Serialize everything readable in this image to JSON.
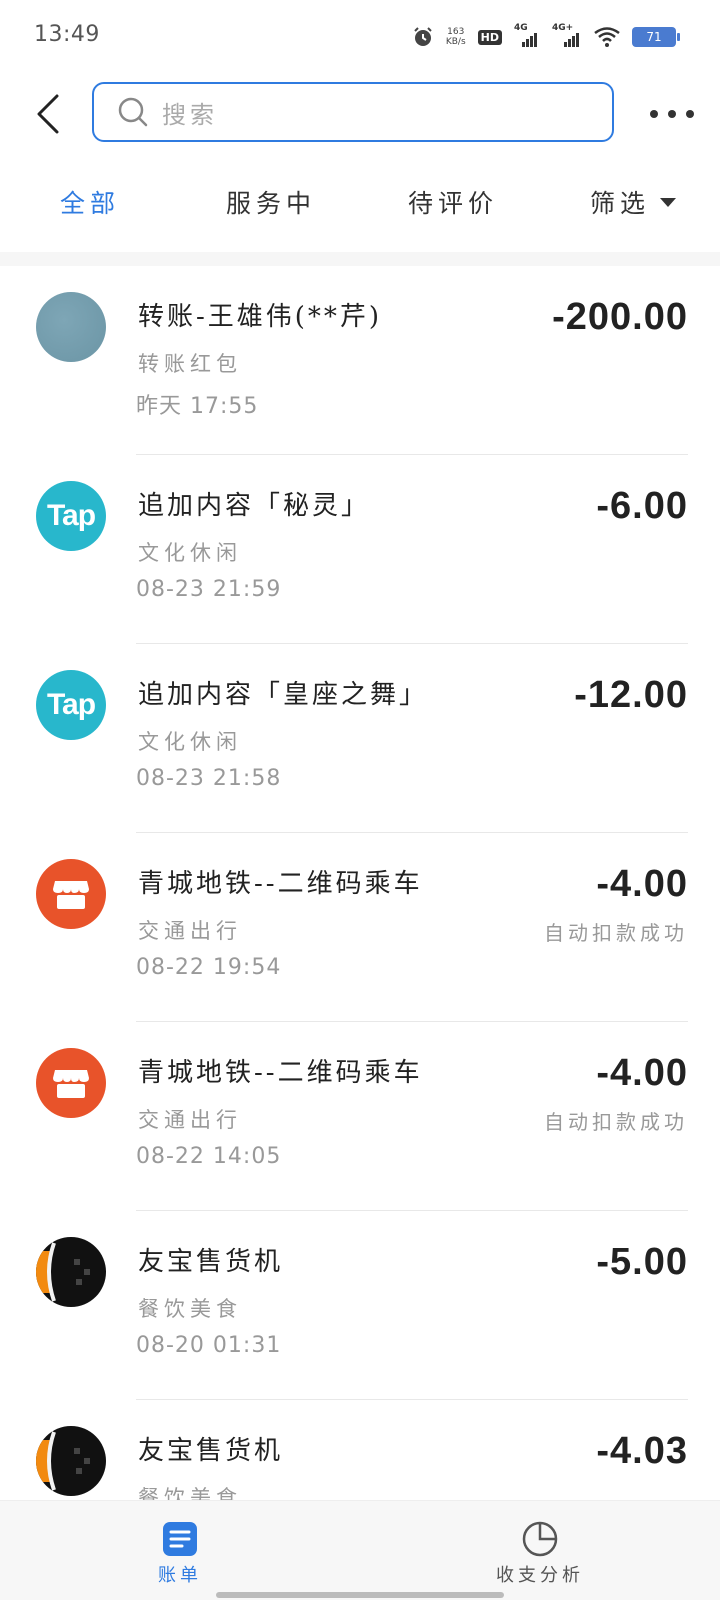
{
  "status_bar": {
    "time": "13:49",
    "net_speed_value": "163",
    "net_speed_unit": "KB/s",
    "hd_label": "HD",
    "sig1_label": "4G",
    "sig2_label": "4G+",
    "battery": "71"
  },
  "header": {
    "search_placeholder": "搜索",
    "accent_color": "#2f7be0"
  },
  "tabs": [
    {
      "label": "全部",
      "active": true
    },
    {
      "label": "服务中",
      "active": false
    },
    {
      "label": "待评价",
      "active": false
    },
    {
      "label": "筛选",
      "active": false
    }
  ],
  "transactions": [
    {
      "title": "转账-王雄伟(**芹)",
      "category": "转账红包",
      "time": "昨天 17:55",
      "amount": "-200.00",
      "status": "",
      "icon": "contact-avatar"
    },
    {
      "title": "追加内容「秘灵」",
      "category": "文化休闲",
      "time": "08-23 21:59",
      "amount": "-6.00",
      "status": "",
      "icon": "tap-logo",
      "icon_text": "Tap"
    },
    {
      "title": "追加内容「皇座之舞」",
      "category": "文化休闲",
      "time": "08-23 21:58",
      "amount": "-12.00",
      "status": "",
      "icon": "tap-logo",
      "icon_text": "Tap"
    },
    {
      "title": "青城地铁--二维码乘车",
      "category": "交通出行",
      "time": "08-22 19:54",
      "amount": "-4.00",
      "status": "自动扣款成功",
      "icon": "store-icon"
    },
    {
      "title": "青城地铁--二维码乘车",
      "category": "交通出行",
      "time": "08-22 14:05",
      "amount": "-4.00",
      "status": "自动扣款成功",
      "icon": "store-icon"
    },
    {
      "title": "友宝售货机",
      "category": "餐饮美食",
      "time": "08-20 01:31",
      "amount": "-5.00",
      "status": "",
      "icon": "vending-avatar"
    },
    {
      "title": "友宝售货机",
      "category": "餐饮美食",
      "time": "",
      "amount": "-4.03",
      "status": "",
      "icon": "vending-avatar"
    }
  ],
  "bottom_nav": {
    "bill_label": "账单",
    "analysis_label": "收支分析"
  }
}
